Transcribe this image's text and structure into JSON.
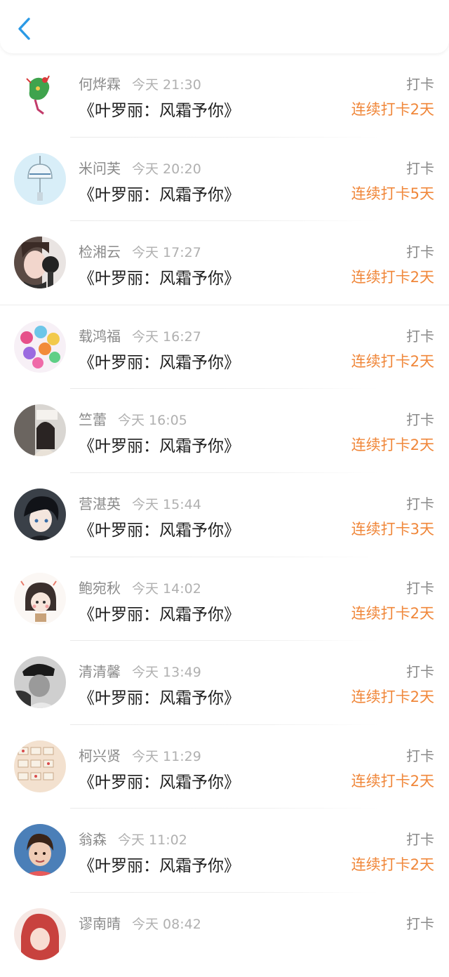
{
  "header": {
    "back_icon": "chevron-left-icon",
    "accent": "#2b9ae6"
  },
  "colors": {
    "streak": "#f0873a",
    "name": "#8a8a8a",
    "time": "#b0b0b0"
  },
  "items": [
    {
      "name": "何烨霖",
      "time": "今天 21:30",
      "book": "《叶罗丽：风霜予你》",
      "action": "打卡",
      "streak": "连续打卡2天",
      "avatar": "avatar-dragon"
    },
    {
      "name": "米问芙",
      "time": "今天 20:20",
      "book": "《叶罗丽：风霜予你》",
      "action": "打卡",
      "streak": "连续打卡5天",
      "avatar": "avatar-windchime"
    },
    {
      "name": "检湘云",
      "time": "今天 17:27",
      "book": "《叶罗丽：风霜予你》",
      "action": "打卡",
      "streak": "连续打卡2天",
      "avatar": "avatar-singer"
    },
    {
      "name": "载鸿福",
      "time": "今天 16:27",
      "book": "《叶罗丽：风霜予你》",
      "action": "打卡",
      "streak": "连续打卡2天",
      "avatar": "avatar-candy"
    },
    {
      "name": "竺蕾",
      "time": "今天 16:05",
      "book": "《叶罗丽：风霜予你》",
      "action": "打卡",
      "streak": "连续打卡2天",
      "avatar": "avatar-girl-street"
    },
    {
      "name": "营湛英",
      "time": "今天 15:44",
      "book": "《叶罗丽：风霜予你》",
      "action": "打卡",
      "streak": "连续打卡3天",
      "avatar": "avatar-anime-boy"
    },
    {
      "name": "鲍宛秋",
      "time": "今天 14:02",
      "book": "《叶罗丽：风霜予你》",
      "action": "打卡",
      "streak": "连续打卡2天",
      "avatar": "avatar-cartoon-girl"
    },
    {
      "name": "清清馨",
      "time": "今天 13:49",
      "book": "《叶罗丽：风霜予你》",
      "action": "打卡",
      "streak": "连续打卡2天",
      "avatar": "avatar-bw-photo"
    },
    {
      "name": "柯兴贤",
      "time": "今天 11:29",
      "book": "《叶罗丽：风霜予你》",
      "action": "打卡",
      "streak": "连续打卡2天",
      "avatar": "avatar-stickers"
    },
    {
      "name": "翁森",
      "time": "今天 11:02",
      "book": "《叶罗丽：风霜予你》",
      "action": "打卡",
      "streak": "连续打卡2天",
      "avatar": "avatar-boy"
    },
    {
      "name": "谬南晴",
      "time": "今天 08:42",
      "book": "",
      "action": "打卡",
      "streak": "",
      "avatar": "avatar-red-hair"
    }
  ]
}
